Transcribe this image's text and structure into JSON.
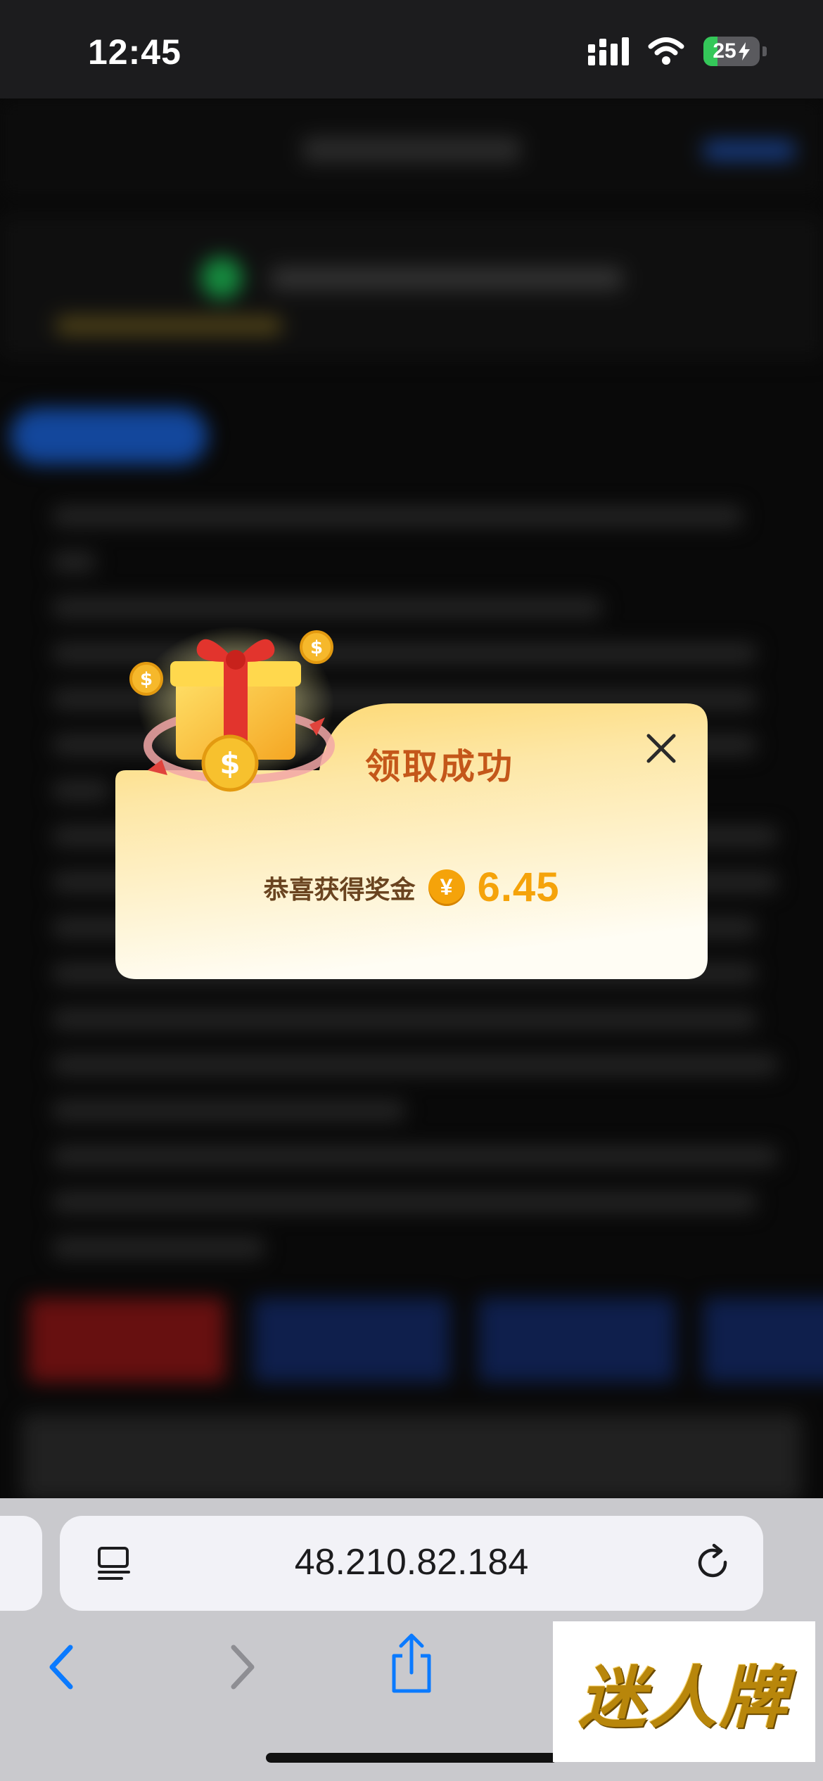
{
  "status_bar": {
    "time": "12:45",
    "battery_level": "25",
    "battery_percent": 25,
    "icons": [
      "cellular-signal-icon",
      "wifi-icon",
      "battery-charging-icon"
    ]
  },
  "modal": {
    "title": "领取成功",
    "reward_label": "恭喜获得奖金",
    "currency_symbol": "¥",
    "reward_amount": "6.45",
    "icons": [
      "gift-box-icon",
      "close-icon",
      "yuan-coin-icon"
    ]
  },
  "browser": {
    "url": "48.210.82.184",
    "icons": [
      "reader-icon",
      "reload-icon",
      "back-icon",
      "forward-icon",
      "share-icon"
    ]
  },
  "watermark": {
    "text": "迷人牌"
  },
  "colors": {
    "accent_gold": "#f5a30a",
    "title_orange": "#c4571a",
    "modal_top": "#fde08a",
    "modal_bottom": "#fffdf4",
    "ios_blue": "#0a7aff"
  }
}
